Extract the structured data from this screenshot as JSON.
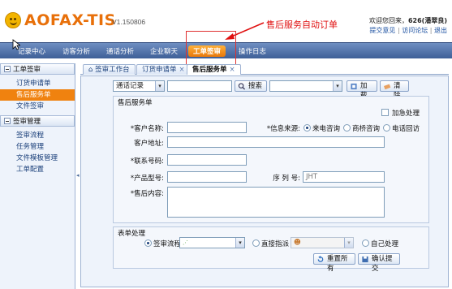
{
  "header": {
    "logo": "AOFAX-TIS",
    "version": "V1.150806",
    "annotation": "售后服务自动订单",
    "welcome_prefix": "欢迎您回来，",
    "welcome_user": "626(潘翠良)",
    "links": [
      "提交意见",
      "访问论坛",
      "退出"
    ]
  },
  "nav": {
    "items": [
      "记录中心",
      "访客分析",
      "通话分析",
      "企业聊天",
      "工单签审",
      "操作日志"
    ],
    "active_index": 4
  },
  "sidebar": {
    "sections": [
      {
        "title": "工单签审",
        "items": [
          "订货申请单",
          "售后服务单",
          "文件签审"
        ],
        "active": 1
      },
      {
        "title": "签审管理",
        "items": [
          "签审流程",
          "任务管理",
          "文件模板管理",
          "工单配置"
        ]
      }
    ]
  },
  "tabs": [
    {
      "label": "签审工作台",
      "closable": false
    },
    {
      "label": "订货申请单",
      "closable": true
    },
    {
      "label": "售后服务单",
      "closable": true
    }
  ],
  "toolbar": {
    "record_select": "通话记录",
    "search_label": "搜索",
    "load_label": "加载",
    "clear_label": "清除"
  },
  "form": {
    "legend": "售后服务单",
    "urgent_label": "加急处理",
    "customer_name_label": "*客户名称:",
    "info_source_label": "*信息来源:",
    "info_source_options": [
      "来电咨询",
      "商桥咨询",
      "电话回访"
    ],
    "info_source_selected": 0,
    "address_label": "客户地址:",
    "contact_label": "*联系号码:",
    "product_label": "*产品型号:",
    "serial_label": "序 列 号:",
    "serial_placeholder": "JHT",
    "content_label": "*售后内容:"
  },
  "process": {
    "legend": "表单处理",
    "options": [
      "签审流程",
      "直接指派",
      "自己处理"
    ],
    "selected": 0,
    "reset_label": "重置所有",
    "submit_label": "确认提交"
  }
}
